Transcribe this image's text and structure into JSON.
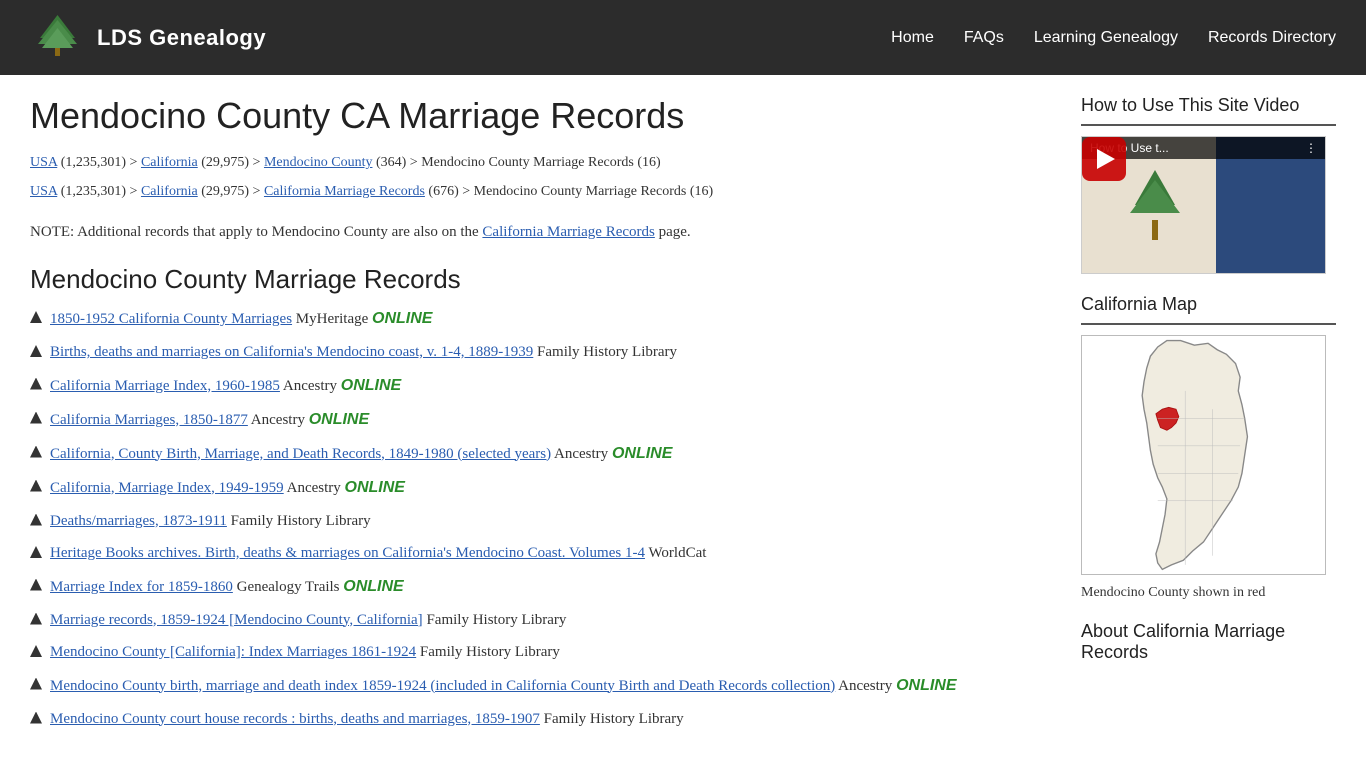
{
  "header": {
    "logo_text": "LDS Genealogy",
    "nav_items": [
      {
        "label": "Home",
        "href": "#"
      },
      {
        "label": "FAQs",
        "href": "#"
      },
      {
        "label": "Learning Genealogy",
        "href": "#"
      },
      {
        "label": "Records Directory",
        "href": "#"
      }
    ]
  },
  "page": {
    "title": "Mendocino County CA Marriage Records",
    "breadcrumbs": [
      {
        "parts": [
          {
            "text": "USA",
            "link": true
          },
          {
            "text": " (1,235,301) > ",
            "link": false
          },
          {
            "text": "California",
            "link": true
          },
          {
            "text": " (29,975) > ",
            "link": false
          },
          {
            "text": "Mendocino County",
            "link": true
          },
          {
            "text": " (364) > Mendocino County Marriage Records (16)",
            "link": false
          }
        ]
      },
      {
        "parts": [
          {
            "text": "USA",
            "link": true
          },
          {
            "text": " (1,235,301) > ",
            "link": false
          },
          {
            "text": "California",
            "link": true
          },
          {
            "text": " (29,975) > ",
            "link": false
          },
          {
            "text": "California Marriage Records",
            "link": true
          },
          {
            "text": " (676) > Mendocino County Marriage Records (16)",
            "link": false
          }
        ]
      }
    ],
    "note": "NOTE: Additional records that apply to Mendocino County are also on the",
    "note_link": "California Marriage Records",
    "note_suffix": "page.",
    "section_title": "Mendocino County Marriage Records",
    "records": [
      {
        "link_text": "1850-1952 California County Marriages",
        "suffix": " MyHeritage",
        "online": true
      },
      {
        "link_text": "Births, deaths and marriages on California's Mendocino coast, v. 1-4, 1889-1939",
        "suffix": " Family History Library",
        "online": false
      },
      {
        "link_text": "California Marriage Index, 1960-1985",
        "suffix": " Ancestry",
        "online": true
      },
      {
        "link_text": "California Marriages, 1850-1877",
        "suffix": " Ancestry",
        "online": true
      },
      {
        "link_text": "California, County Birth, Marriage, and Death Records, 1849-1980 (selected years)",
        "suffix": " Ancestry",
        "online": true
      },
      {
        "link_text": "California, Marriage Index, 1949-1959",
        "suffix": " Ancestry",
        "online": true
      },
      {
        "link_text": "Deaths/marriages, 1873-1911",
        "suffix": " Family History Library",
        "online": false
      },
      {
        "link_text": "Heritage Books archives. Birth, deaths & marriages on California's Mendocino Coast. Volumes 1-4",
        "suffix": " WorldCat",
        "online": false
      },
      {
        "link_text": "Marriage Index for 1859-1860",
        "suffix": " Genealogy Trails",
        "online": true
      },
      {
        "link_text": "Marriage records, 1859-1924 [Mendocino County, California]",
        "suffix": " Family History Library",
        "online": false
      },
      {
        "link_text": "Mendocino County [California]: Index Marriages 1861-1924",
        "suffix": " Family History Library",
        "online": false
      },
      {
        "link_text": "Mendocino County birth, marriage and death index 1859-1924 (included in California County Birth and Death Records collection)",
        "suffix": " Ancestry",
        "online": true
      },
      {
        "link_text": "Mendocino County court house records : births, deaths and marriages, 1859-1907",
        "suffix": " Family History Library",
        "online": false
      }
    ]
  },
  "sidebar": {
    "video_title": "How to Use This Site Video",
    "video_thumb_text": "How to Use t...",
    "map_title": "California Map",
    "map_caption": "Mendocino County shown in red",
    "about_title": "About California Marriage Records",
    "online_label": "ONLINE"
  }
}
